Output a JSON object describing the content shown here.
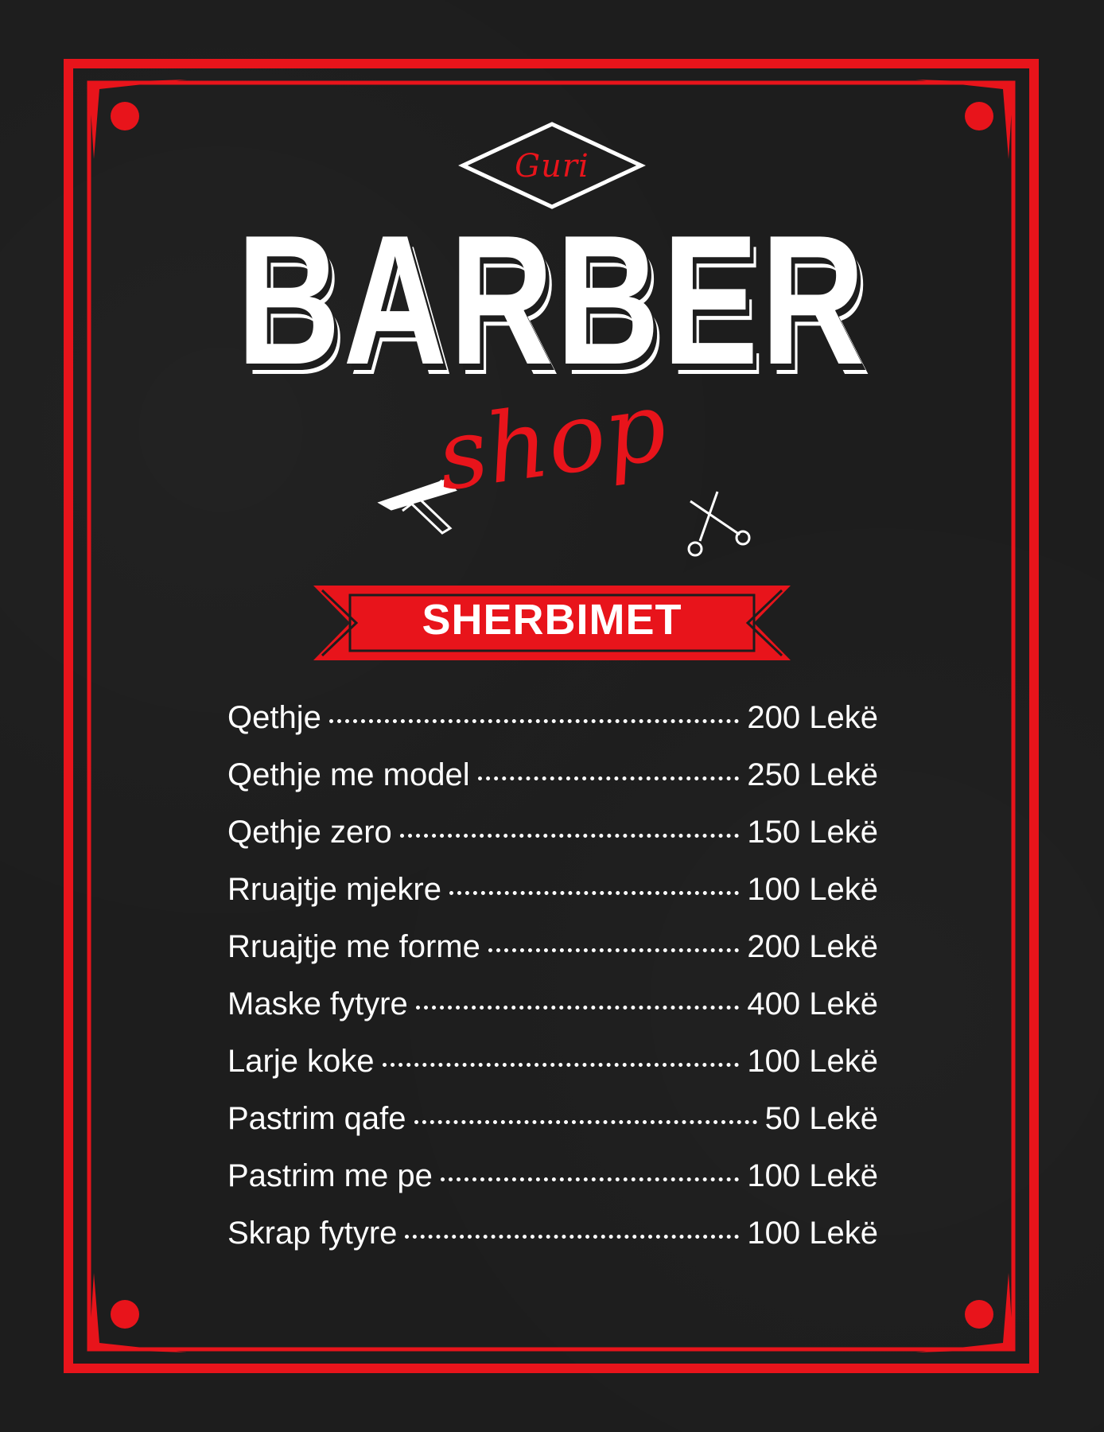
{
  "brand": {
    "name_small": "Guri",
    "title": "BARBER",
    "subtitle": "shop"
  },
  "section_label": "SHERBIMET",
  "services": [
    {
      "name": "Qethje",
      "price": "200 Lekë"
    },
    {
      "name": "Qethje me model",
      "price": "250 Lekë"
    },
    {
      "name": "Qethje zero",
      "price": "150 Lekë"
    },
    {
      "name": "Rruajtje mjekre",
      "price": "100 Lekë"
    },
    {
      "name": "Rruajtje me forme",
      "price": "200 Lekë"
    },
    {
      "name": "Maske fytyre",
      "price": "400 Lekë"
    },
    {
      "name": "Larje koke",
      "price": "100 Lekë"
    },
    {
      "name": "Pastrim qafe",
      "price": "50 Lekë"
    },
    {
      "name": "Pastrim me pe",
      "price": "100 Lekë"
    },
    {
      "name": "Skrap fytyre",
      "price": "100 Lekë"
    }
  ],
  "colors": {
    "accent": "#e8141b",
    "background": "#1d1d1d",
    "text": "#ffffff"
  },
  "icons": [
    "straight-razor-icon",
    "scissors-icon"
  ]
}
